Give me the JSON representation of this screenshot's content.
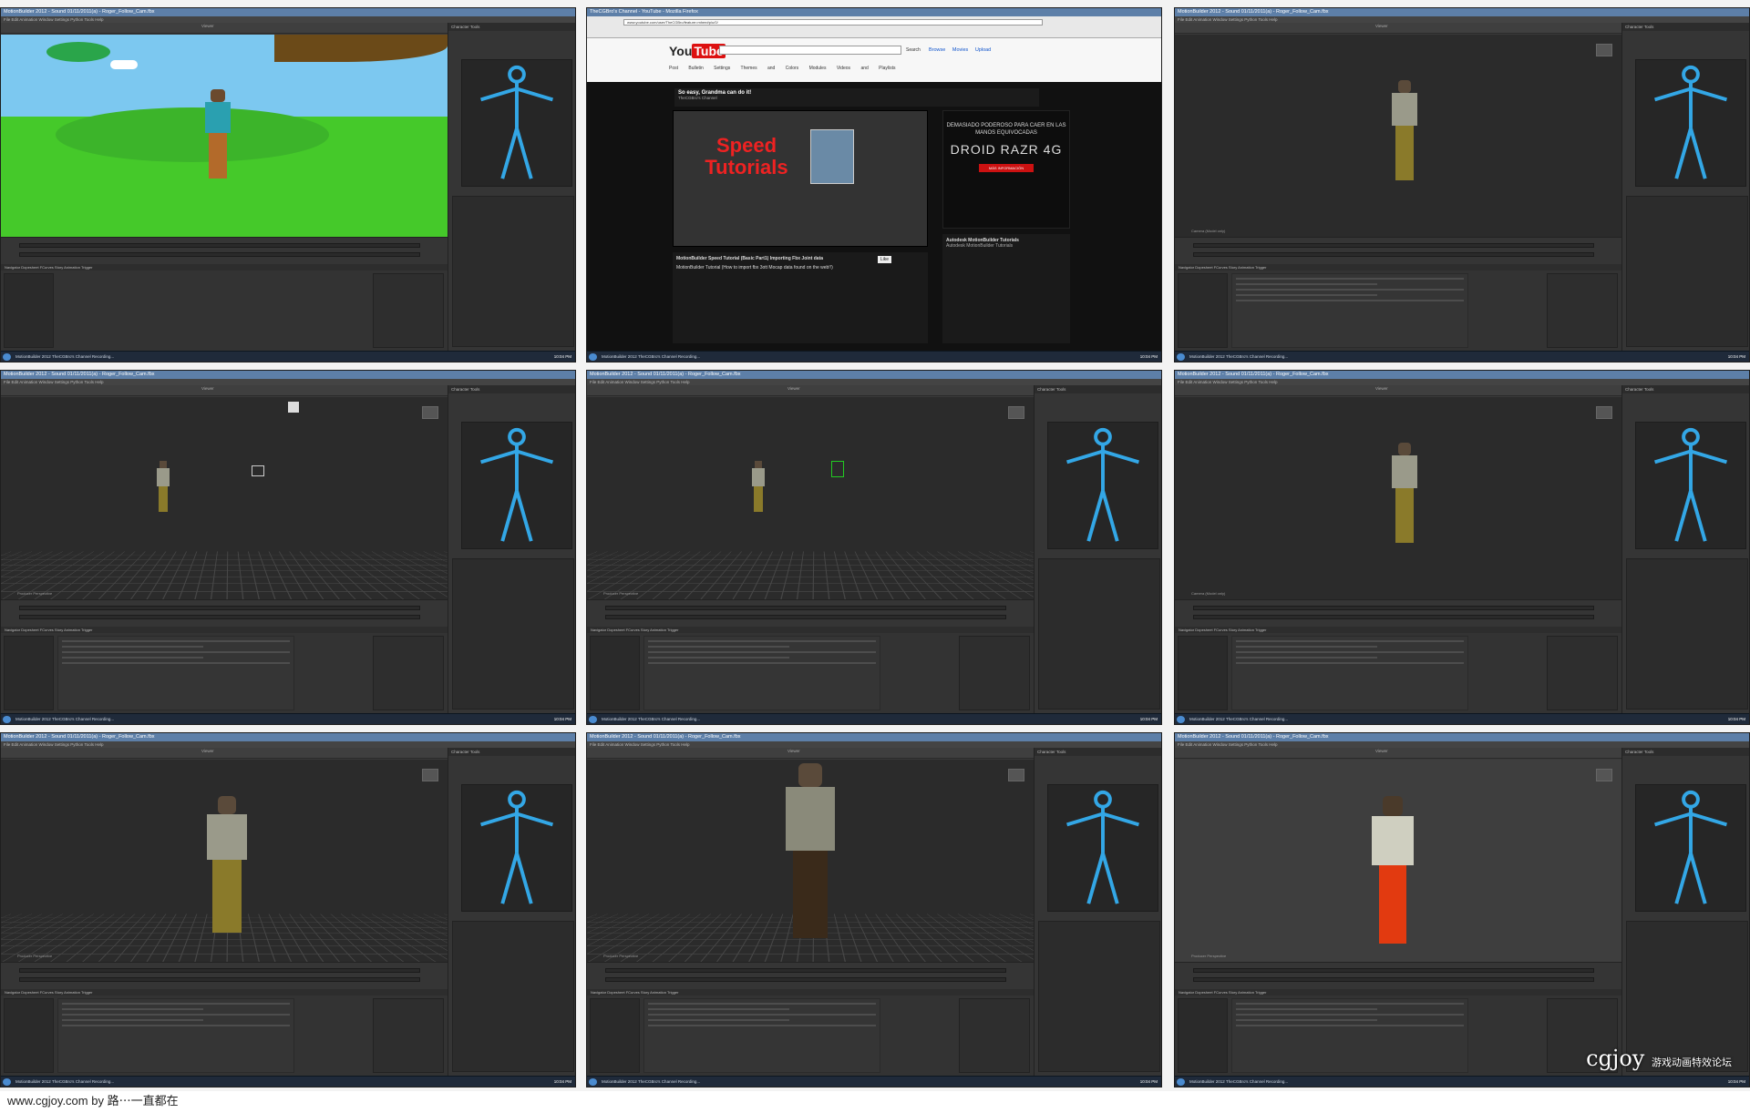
{
  "app": {
    "title": "MotionBuilder 2012 - Sound 01/11/2011(a) - Roger_Follow_Cam.fbx",
    "menu": "File  Edit  Animation  Window  Settings  Python Tools  Help",
    "viewer_label": "Viewer",
    "char_panel_title": "Character Tools",
    "bottom_tabs": "Navigator  Dopesheet  FCurves  Story  Animation Trigger",
    "camera_label_a": "Camera (Model only)",
    "camera_label_b": "Producer Perspective",
    "taskbar_items": "MotionBuilder 2012    TheCGBro's Channel    Recording...",
    "clock": "10:04 PM"
  },
  "youtube": {
    "window_title": "TheCGBro's Channel - YouTube - Mozilla Firefox",
    "address": "www.youtube.com/user/TheCGBro/feature=mhee#p/u/0/",
    "search_button": "Search",
    "nav_links": "Browse  Movies  Upload",
    "channel_tabs": "Post Bulletin  Settings  Themes and Colors  Modules  Videos and Playlists",
    "channel_heading": "So easy, Grandma can do it!",
    "channel_name": "TheCGBro's Channel",
    "speed_text": "Speed Tutorials",
    "ad_text": "DEMASIADO PODEROSO PARA CAER EN LAS MANOS EQUIVOCADAS",
    "ad_brand": "DROID RAZR 4G",
    "ad_button": "MÁS INFORMACIÓN",
    "video_title": "MotionBuilder Speed Tutorial (Basic Part1) Importing Fbx Joint data",
    "video_desc": "MotionBuilder Tutorial (How to import fbx 3ott Mocap data found on the web!!)",
    "side_title": "Autodesk MotionBuilder Tutorials",
    "side_sub": "Autodesk MotionBuilder Tutorials",
    "like": "Like"
  },
  "footer": {
    "text": "www.cgjoy.com by 路⋯一直都在"
  },
  "watermark": {
    "logo": "cgjoy",
    "sub": "游戏动画特效论坛"
  },
  "colors": {
    "titlebar": "#5d7fa8",
    "panel": "#3a3a3a",
    "skeleton": "#33a7e6"
  }
}
